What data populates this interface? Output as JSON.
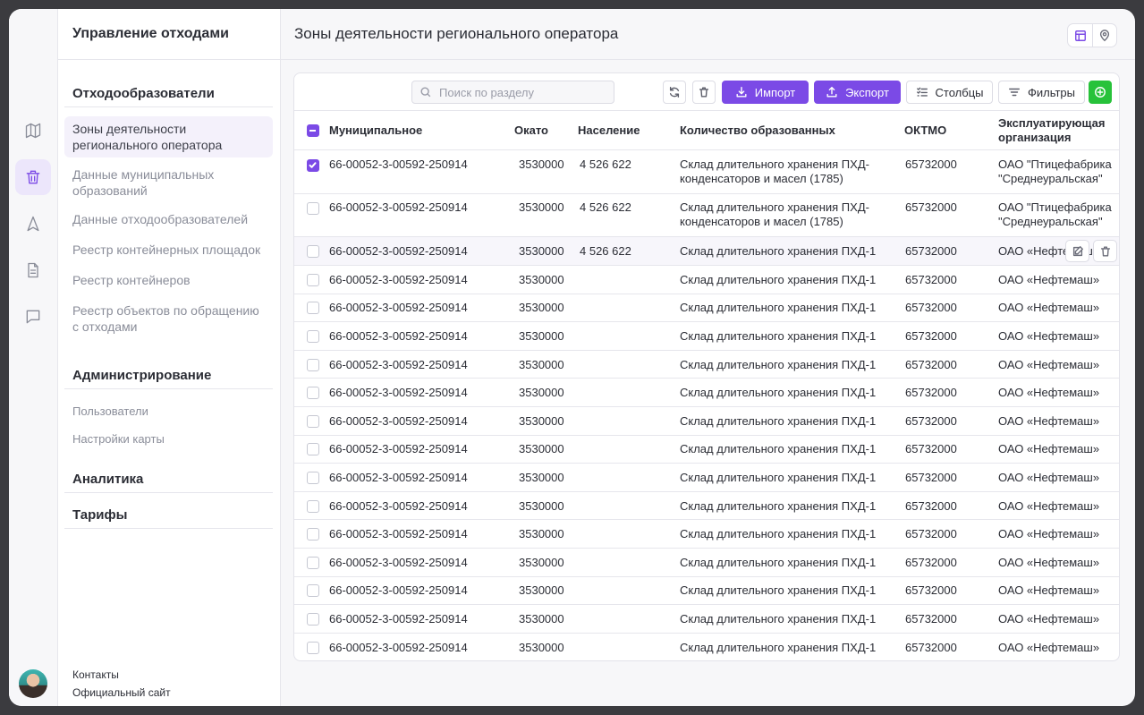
{
  "rail": {
    "icons": [
      "map-icon",
      "trash-icon",
      "navigation-icon",
      "document-icon",
      "chat-icon"
    ],
    "active": "trash-icon"
  },
  "sidebar": {
    "title": "Управление отходами",
    "sections": [
      {
        "title": "Отходообразователи",
        "items": [
          {
            "label": "Зоны деятельности регионального оператора",
            "active": true
          },
          {
            "label": "Данные муниципальных образований",
            "active": false
          },
          {
            "label": "Данные отходообразователей",
            "active": false
          },
          {
            "label": "Реестр контейнерных площадок",
            "active": false
          },
          {
            "label": "Реестр контейнеров",
            "active": false
          },
          {
            "label": "Реестр объектов по обращению с отходами",
            "active": false
          }
        ]
      },
      {
        "title": "Администрирование",
        "items": [
          {
            "label": "Пользователи",
            "active": false
          },
          {
            "label": "Настройки карты",
            "active": false
          }
        ]
      },
      {
        "title": "Аналитика",
        "items": []
      },
      {
        "title": "Тарифы",
        "items": []
      }
    ],
    "footer": {
      "contacts": "Контакты",
      "site": "Официальный сайт"
    }
  },
  "header": {
    "title": "Зоны деятельности регионального оператора"
  },
  "toolbar": {
    "search_placeholder": "Поиск по разделу",
    "import_label": "Импорт",
    "export_label": "Экспорт",
    "columns_label": "Столбцы",
    "filters_label": "Фильтры"
  },
  "table": {
    "columns": [
      "Муниципальное",
      "Окато",
      "Население",
      "Количество образованных",
      "ОКТМО",
      "Эксплуатирующая организация"
    ],
    "rows": [
      {
        "checked": true,
        "mun": "66-00052-3-00592-250914",
        "okato": "3530000",
        "pop": "4 526 622",
        "qty": "Склад длительного хранения ПХД-конденсаторов и масел (1785)",
        "oktmo": "65732000",
        "org": "ОАО \"Птицефабрика \"Среднеуральская\""
      },
      {
        "checked": false,
        "mun": "66-00052-3-00592-250914",
        "okato": "3530000",
        "pop": "4 526 622",
        "qty": "Склад длительного хранения ПХД-конденсаторов и масел (1785)",
        "oktmo": "65732000",
        "org": "ОАО \"Птицефабрика \"Среднеуральская\""
      },
      {
        "checked": false,
        "mun": "66-00052-3-00592-250914",
        "okato": "3530000",
        "pop": "4 526 622",
        "qty": "Склад длительного хранения ПХД-1",
        "oktmo": "65732000",
        "org": "ОАО «Нефтемаш»",
        "hover": true
      },
      {
        "checked": false,
        "mun": "66-00052-3-00592-250914",
        "okato": "3530000",
        "pop": "",
        "qty": "Склад длительного хранения ПХД-1",
        "oktmo": "65732000",
        "org": "ОАО «Нефтемаш»"
      },
      {
        "checked": false,
        "mun": "66-00052-3-00592-250914",
        "okato": "3530000",
        "pop": "",
        "qty": "Склад длительного хранения ПХД-1",
        "oktmo": "65732000",
        "org": "ОАО «Нефтемаш»"
      },
      {
        "checked": false,
        "mun": "66-00052-3-00592-250914",
        "okato": "3530000",
        "pop": "",
        "qty": "Склад длительного хранения ПХД-1",
        "oktmo": "65732000",
        "org": "ОАО «Нефтемаш»"
      },
      {
        "checked": false,
        "mun": "66-00052-3-00592-250914",
        "okato": "3530000",
        "pop": "",
        "qty": "Склад длительного хранения ПХД-1",
        "oktmo": "65732000",
        "org": "ОАО «Нефтемаш»"
      },
      {
        "checked": false,
        "mun": "66-00052-3-00592-250914",
        "okato": "3530000",
        "pop": "",
        "qty": "Склад длительного хранения ПХД-1",
        "oktmo": "65732000",
        "org": "ОАО «Нефтемаш»"
      },
      {
        "checked": false,
        "mun": "66-00052-3-00592-250914",
        "okato": "3530000",
        "pop": "",
        "qty": "Склад длительного хранения ПХД-1",
        "oktmo": "65732000",
        "org": "ОАО «Нефтемаш»"
      },
      {
        "checked": false,
        "mun": "66-00052-3-00592-250914",
        "okato": "3530000",
        "pop": "",
        "qty": "Склад длительного хранения ПХД-1",
        "oktmo": "65732000",
        "org": "ОАО «Нефтемаш»"
      },
      {
        "checked": false,
        "mun": "66-00052-3-00592-250914",
        "okato": "3530000",
        "pop": "",
        "qty": "Склад длительного хранения ПХД-1",
        "oktmo": "65732000",
        "org": "ОАО «Нефтемаш»"
      },
      {
        "checked": false,
        "mun": "66-00052-3-00592-250914",
        "okato": "3530000",
        "pop": "",
        "qty": "Склад длительного хранения ПХД-1",
        "oktmo": "65732000",
        "org": "ОАО «Нефтемаш»"
      },
      {
        "checked": false,
        "mun": "66-00052-3-00592-250914",
        "okato": "3530000",
        "pop": "",
        "qty": "Склад длительного хранения ПХД-1",
        "oktmo": "65732000",
        "org": "ОАО «Нефтемаш»"
      },
      {
        "checked": false,
        "mun": "66-00052-3-00592-250914",
        "okato": "3530000",
        "pop": "",
        "qty": "Склад длительного хранения ПХД-1",
        "oktmo": "65732000",
        "org": "ОАО «Нефтемаш»"
      },
      {
        "checked": false,
        "mun": "66-00052-3-00592-250914",
        "okato": "3530000",
        "pop": "",
        "qty": "Склад длительного хранения ПХД-1",
        "oktmo": "65732000",
        "org": "ОАО «Нефтемаш»"
      },
      {
        "checked": false,
        "mun": "66-00052-3-00592-250914",
        "okato": "3530000",
        "pop": "",
        "qty": "Склад длительного хранения ПХД-1",
        "oktmo": "65732000",
        "org": "ОАО «Нефтемаш»"
      },
      {
        "checked": false,
        "mun": "66-00052-3-00592-250914",
        "okato": "3530000",
        "pop": "",
        "qty": "Склад длительного хранения ПХД-1",
        "oktmo": "65732000",
        "org": "ОАО «Нефтемаш»"
      }
    ]
  },
  "colors": {
    "accent": "#7b4ae6",
    "add": "#27c23a",
    "row_hover": "#f7f6fb"
  }
}
